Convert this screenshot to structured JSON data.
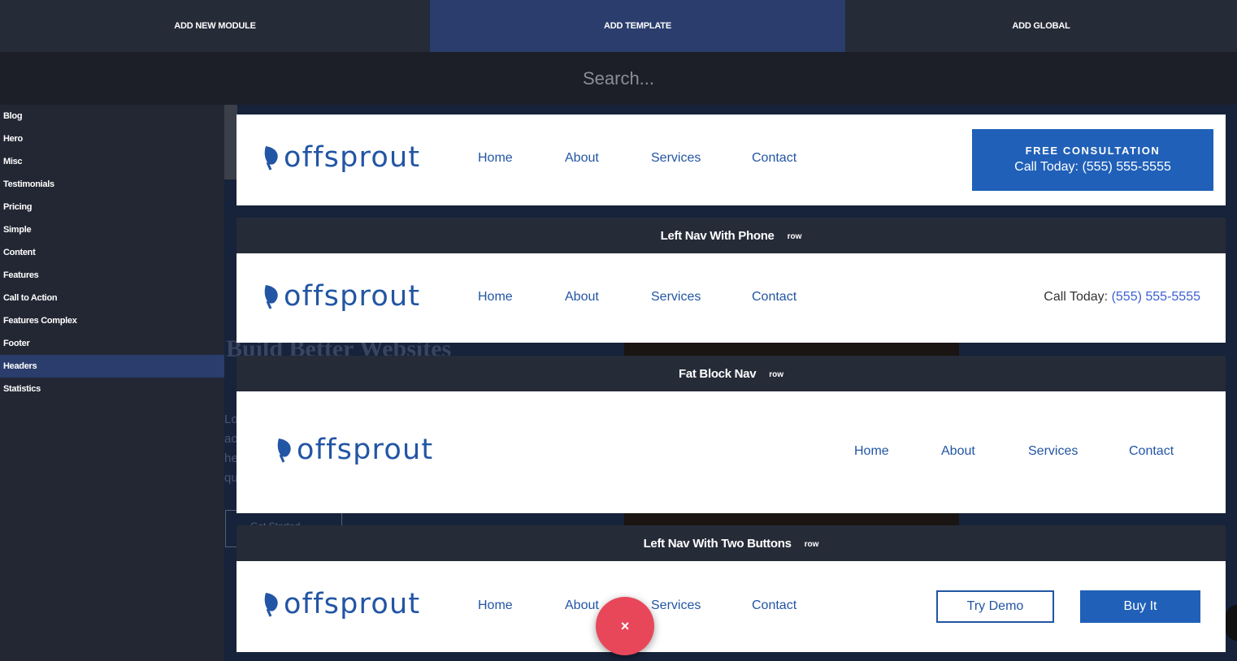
{
  "tabs": [
    {
      "label": "ADD NEW MODULE"
    },
    {
      "label": "ADD TEMPLATE"
    },
    {
      "label": "ADD GLOBAL"
    }
  ],
  "search": {
    "placeholder": "Search..."
  },
  "sidebar": {
    "items": [
      {
        "label": "Blog"
      },
      {
        "label": "Hero"
      },
      {
        "label": "Misc"
      },
      {
        "label": "Testimonials"
      },
      {
        "label": "Pricing"
      },
      {
        "label": "Simple"
      },
      {
        "label": "Content"
      },
      {
        "label": "Features"
      },
      {
        "label": "Call to Action"
      },
      {
        "label": "Features Complex"
      },
      {
        "label": "Footer"
      },
      {
        "label": "Headers"
      },
      {
        "label": "Statistics"
      }
    ],
    "active": "Headers"
  },
  "background_page": {
    "headline": "Build Better Websites",
    "para_fragment": "Lo ac he qu",
    "button": "Get Started"
  },
  "templates": [
    {
      "logo": "offsprout",
      "nav": [
        "Home",
        "About",
        "Services",
        "Contact"
      ],
      "cta_line1": "FREE CONSULTATION",
      "cta_line2": "Call Today: (555) 555-5555"
    },
    {
      "title": "Left Nav With Phone",
      "tag": "row",
      "logo": "offsprout",
      "nav": [
        "Home",
        "About",
        "Services",
        "Contact"
      ],
      "phone_label": "Call Today:",
      "phone_number": "(555) 555-5555"
    },
    {
      "title": "Fat Block Nav",
      "tag": "row",
      "logo": "offsprout",
      "nav": [
        "Home",
        "About",
        "Services",
        "Contact"
      ]
    },
    {
      "title": "Left Nav With Two Buttons",
      "tag": "row",
      "logo": "offsprout",
      "nav": [
        "Home",
        "About",
        "Services",
        "Contact"
      ],
      "button_outline": "Try Demo",
      "button_solid": "Buy It"
    }
  ],
  "close_button": {
    "label": "×"
  },
  "colors": {
    "brand_blue": "#2255a4",
    "cta_blue": "#2060b8",
    "active_tab": "#2a3d6c",
    "close_red": "#e8475a"
  },
  "icons": {
    "logo": "leaf-icon",
    "close": "close-icon"
  }
}
